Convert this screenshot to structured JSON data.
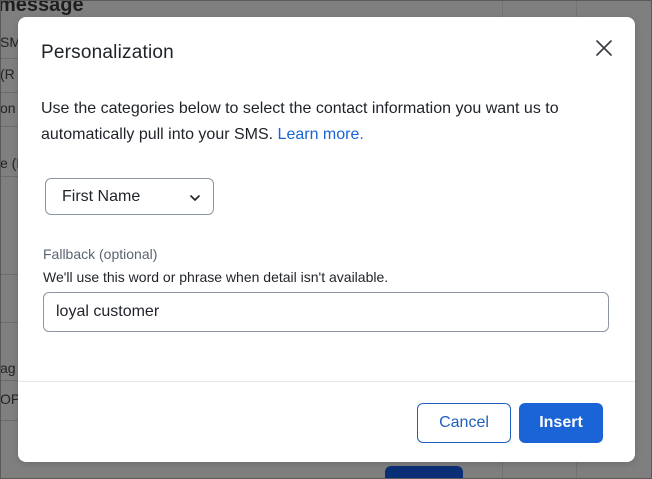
{
  "background": {
    "heading_fragment": "message",
    "text_fragments": [
      "SM",
      "(R",
      "on",
      "e (F",
      "ag",
      "OP"
    ]
  },
  "modal": {
    "title": "Personalization",
    "close_icon": "close-icon",
    "description": "Use the categories below to select the contact information you want us to automatically pull into your SMS.",
    "learn_more_label": "Learn more.",
    "field_select": {
      "selected_value": "First Name",
      "chevron_icon": "chevron-down-icon"
    },
    "fallback": {
      "label": "Fallback (optional)",
      "help_text": "We'll use this word or phrase when detail isn't available.",
      "value": "loyal customer"
    },
    "footer": {
      "cancel_label": "Cancel",
      "insert_label": "Insert"
    }
  },
  "colors": {
    "primary": "#1a64d8",
    "text": "#1f2329",
    "muted_text": "#5b6472",
    "border": "#8e96a2",
    "overlay": "#7f7f7f"
  }
}
